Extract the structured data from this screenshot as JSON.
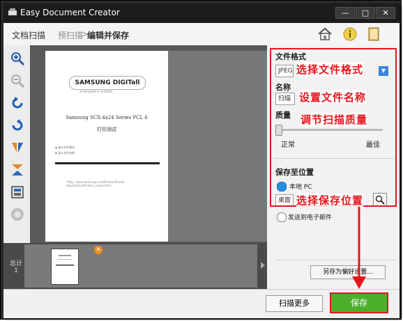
{
  "window": {
    "title": "Easy Document Creator",
    "controls": {
      "minimize": "—",
      "maximize": "□",
      "close": "✕"
    }
  },
  "breadcrumb": {
    "step1": "文档扫描",
    "step2": "预扫描",
    "separator": ">",
    "step3": "编辑并保存"
  },
  "toolbar_icons": [
    "home-icon",
    "info-icon",
    "book-icon"
  ],
  "left_tools": [
    "zoom-in-icon",
    "zoom-out-icon",
    "rotate-left-icon",
    "rotate-right-icon",
    "flip-horizontal-icon",
    "flip-vertical-icon",
    "crop-icon",
    "reset-icon"
  ],
  "preview": {
    "logo": "SAMSUNG DIGITall",
    "tagline": "everyone's invited",
    "heading": "Samsung SCX-4x24 Series PCL 6",
    "subheading": "打印测试",
    "bullet1": "▪ 该么文件格式",
    "bullet2": "▪ 该么文件名称",
    "footer": "\"http : www.samsung.com/Printers/Printer Registration/Printers_signal.htm\""
  },
  "strip": {
    "total_label": "总计",
    "total_count": "1",
    "remove_badge": "✕"
  },
  "panel": {
    "format_label": "文件格式",
    "format_value": "JPEG",
    "name_label": "名称",
    "name_value": "扫描",
    "quality_label": "质量",
    "quality_level": 0.0,
    "quality_min": "正常",
    "quality_max": "最佳",
    "save_to_label": "保存至位置",
    "local_pc_label": "本地 PC",
    "location_value": "桌面",
    "email_label": "发送到电子邮件",
    "save_as_pref": "另存为偏好设置..."
  },
  "annotations": {
    "format": "选择文件格式",
    "name": "设置文件名称",
    "quality": "调节扫描质量",
    "location": "选择保存位置"
  },
  "buttons": {
    "scan_more": "扫描更多",
    "save": "保存"
  },
  "colors": {
    "annotation_red": "#e8141c",
    "save_green": "#4caf2c",
    "radio_blue": "#2a8ee0",
    "titlebar": "#1c1c1c"
  }
}
